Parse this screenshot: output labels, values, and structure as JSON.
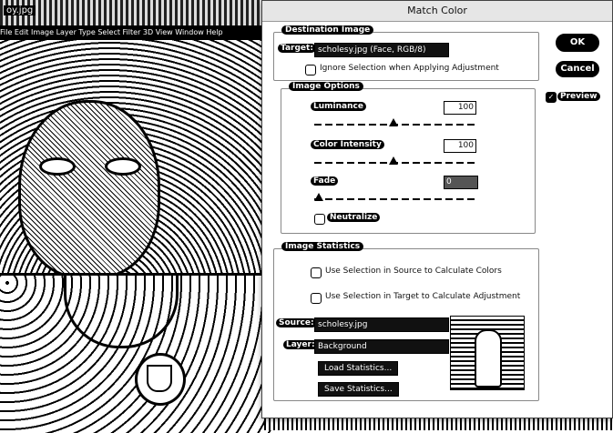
{
  "photo": {
    "title": "oy.jpg",
    "menu_text": "File  Edit  Image  Layer  Type  Select  Filter  3D  View  Window  Help"
  },
  "dialog": {
    "title": "Match Color",
    "destination": {
      "group_label": "Destination Image",
      "target_label": "Target:",
      "target_value": "scholesy.jpg (Face, RGB/8)",
      "ignore_selection_label": "Ignore Selection when Applying Adjustment"
    },
    "image_options": {
      "group_label": "Image Options",
      "luminance_label": "Luminance",
      "luminance_value": "100",
      "color_intensity_label": "Color Intensity",
      "color_intensity_value": "100",
      "fade_label": "Fade",
      "fade_value": "0",
      "neutralize_label": "Neutralize"
    },
    "image_statistics": {
      "group_label": "Image Statistics",
      "use_selection_source_label": "Use Selection in Source to Calculate Colors",
      "use_selection_target_label": "Use Selection in Target to Calculate Adjustment",
      "source_label": "Source:",
      "source_value": "scholesy.jpg",
      "layer_label": "Layer:",
      "layer_value": "Background",
      "load_stats_label": "Load Statistics...",
      "save_stats_label": "Save Statistics..."
    },
    "buttons": {
      "ok_label": "OK",
      "cancel_label": "Cancel",
      "preview_label": "Preview"
    },
    "preview_checked": true
  },
  "colors": {
    "accent": "#000000",
    "dialog_bg": "#ffffff",
    "titlebar_bg": "#e6e6e6"
  }
}
